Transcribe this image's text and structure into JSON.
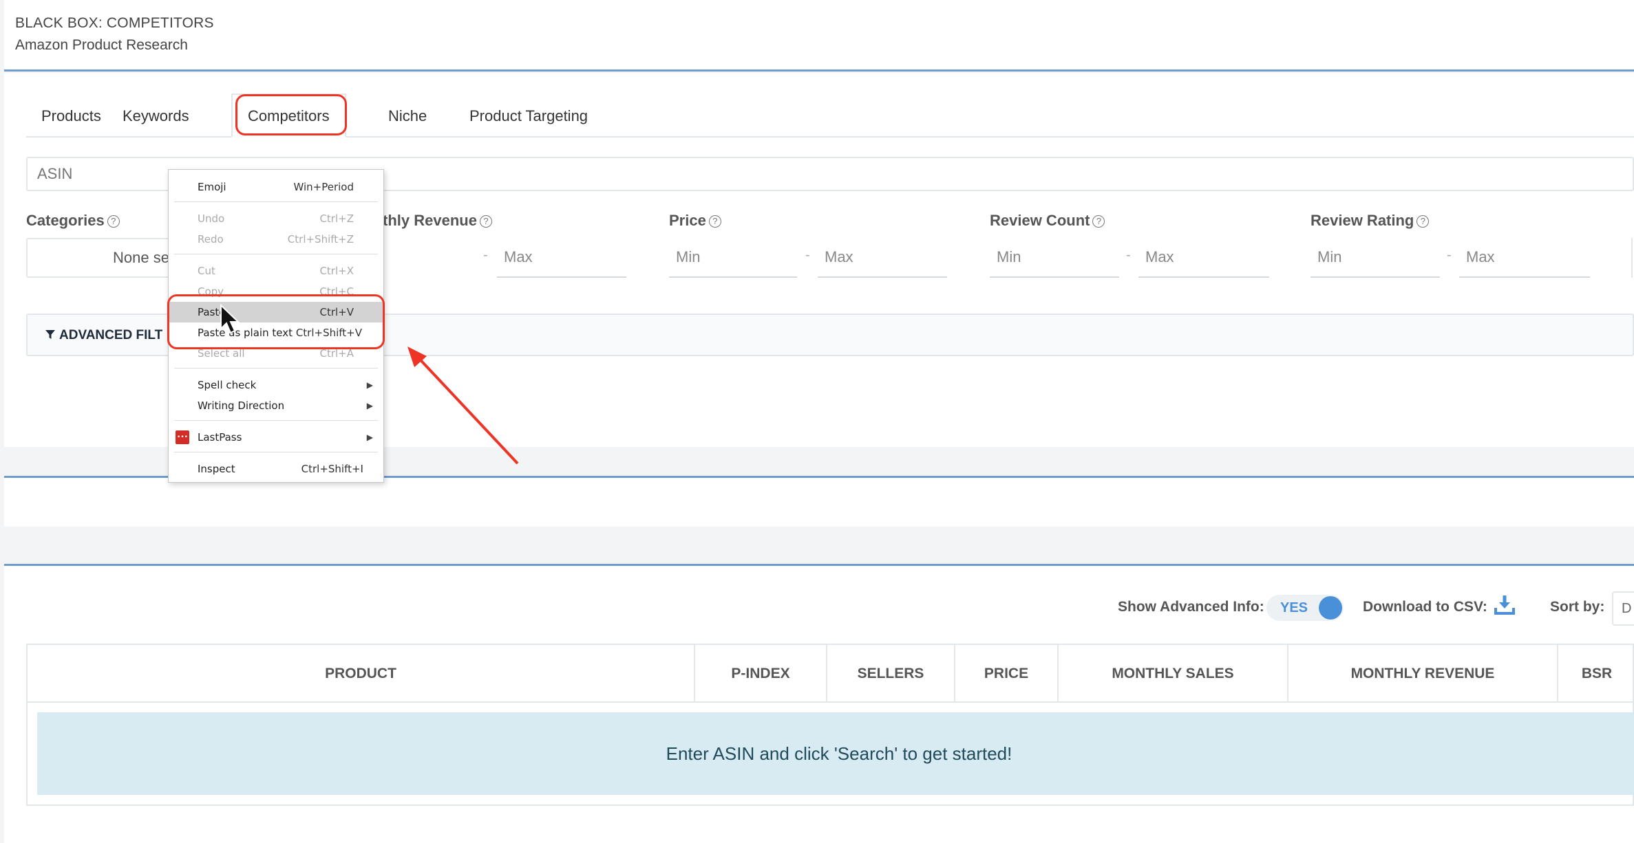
{
  "header": {
    "title": "BLACK BOX: COMPETITORS",
    "subtitle": "Amazon Product Research"
  },
  "tabs": [
    {
      "label": "Products"
    },
    {
      "label": "Keywords"
    },
    {
      "label": "Competitors",
      "active": true
    },
    {
      "label": "Niche"
    },
    {
      "label": "Product Targeting"
    }
  ],
  "asin_input": {
    "placeholder": "ASIN"
  },
  "filters": {
    "categories": {
      "label": "Categories",
      "value": "None se"
    },
    "monthly_revenue": {
      "label": "thly Revenue",
      "max": "Max"
    },
    "price": {
      "label": "Price",
      "min": "Min",
      "max": "Max"
    },
    "review_count": {
      "label": "Review Count",
      "min": "Min",
      "max": "Max"
    },
    "review_rating": {
      "label": "Review Rating",
      "min": "Min",
      "max": "Max"
    },
    "dash": "-"
  },
  "advanced_filters": {
    "label": "ADVANCED FILT"
  },
  "options": {
    "show_advanced_label": "Show Advanced Info:",
    "toggle_value": "YES",
    "download_label": "Download to CSV:",
    "sort_label": "Sort by:",
    "sort_value": "D"
  },
  "table": {
    "columns": [
      "PRODUCT",
      "P-INDEX",
      "SELLERS",
      "PRICE",
      "MONTHLY SALES",
      "MONTHLY REVENUE",
      "BSR"
    ],
    "empty_message": "Enter ASIN and click 'Search' to get started!"
  },
  "context_menu": {
    "items": [
      {
        "label": "Emoji",
        "shortcut": "Win+Period"
      },
      {
        "label": "Undo",
        "shortcut": "Ctrl+Z"
      },
      {
        "label": "Redo",
        "shortcut": "Ctrl+Shift+Z"
      },
      {
        "label": "Cut",
        "shortcut": "Ctrl+X"
      },
      {
        "label": "Copy",
        "shortcut": "Ctrl+C"
      },
      {
        "label": "Paste",
        "shortcut": "Ctrl+V"
      },
      {
        "label": "Paste as plain text",
        "shortcut": "Ctrl+Shift+V"
      },
      {
        "label": "Select all",
        "shortcut": "Ctrl+A"
      },
      {
        "label": "Spell check"
      },
      {
        "label": "Writing Direction"
      },
      {
        "label": "LastPass"
      },
      {
        "label": "Inspect",
        "shortcut": "Ctrl+Shift+I"
      }
    ],
    "lastpass_badge": "•••"
  },
  "colors": {
    "accent": "#4a90d9",
    "annotation": "#ee3424",
    "rule": "#6f9dcc",
    "empty_bg": "#d9ebf2"
  }
}
